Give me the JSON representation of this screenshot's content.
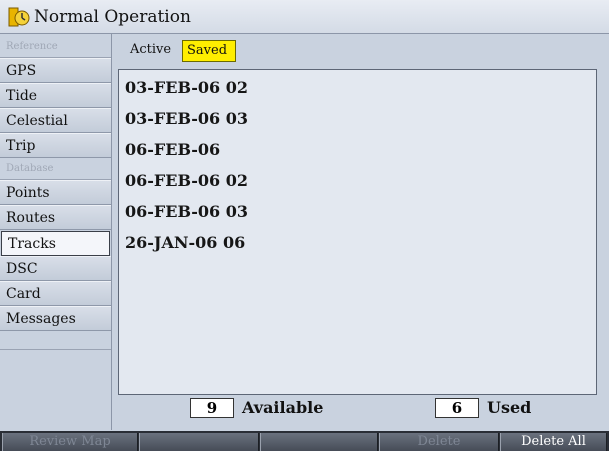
{
  "window": {
    "title": "Normal Operation",
    "icon": "tide-clock-icon"
  },
  "sidebar": {
    "section_reference": "Reference",
    "section_database": "Database",
    "items": [
      {
        "label": "GPS"
      },
      {
        "label": "Tide"
      },
      {
        "label": "Celestial"
      },
      {
        "label": "Trip"
      },
      {
        "label": "Points"
      },
      {
        "label": "Routes"
      },
      {
        "label": "Tracks",
        "selected": true
      },
      {
        "label": "DSC"
      },
      {
        "label": "Card"
      },
      {
        "label": "Messages"
      }
    ]
  },
  "tabs": {
    "active_label": "Active",
    "saved_label": "Saved",
    "selected": "Saved",
    "highlight_color": "#ffee00"
  },
  "tracks": [
    "03-FEB-06 02",
    "03-FEB-06 03",
    "06-FEB-06",
    "06-FEB-06 02",
    "06-FEB-06 03",
    "26-JAN-06 06"
  ],
  "footer": {
    "available_count": "9",
    "available_label": "Available",
    "used_count": "6",
    "used_label": "Used"
  },
  "softkeys": [
    {
      "label": "Review Map",
      "enabled": false
    },
    {
      "label": "",
      "enabled": false
    },
    {
      "label": "",
      "enabled": false
    },
    {
      "label": "Delete",
      "enabled": false
    },
    {
      "label": "Delete All",
      "enabled": true
    }
  ]
}
